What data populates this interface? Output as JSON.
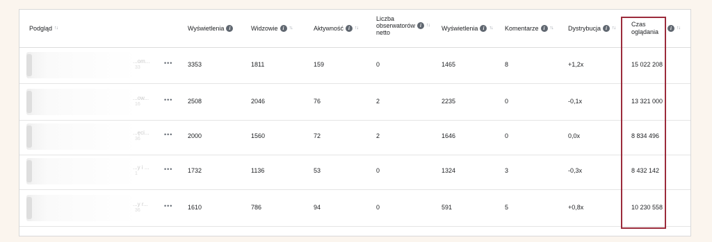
{
  "header": {
    "preview": "Podgląd",
    "views": "Wyświetlenia",
    "viewers": "Widzowie",
    "activity": "Aktywność",
    "followers_l1": "Liczba",
    "followers_l2": "obserwatorów",
    "followers_l3": "netto",
    "views2": "Wyświetlenia",
    "comments": "Komentarze",
    "distribution": "Dystrybucja",
    "watch_l1": "Czas",
    "watch_l2": "oglądania"
  },
  "icons": {
    "info": "info-icon",
    "sort": "sort-arrows-icon",
    "more": "more-options-icon"
  },
  "highlight_color": "#9b2a3a",
  "rows": [
    {
      "title": "...om...",
      "sub": "33",
      "views": "3353",
      "viewers": "1811",
      "activity": "159",
      "followers": "0",
      "views2": "1465",
      "comments": "8",
      "distribution": "+1,2x",
      "watch_time": "15 022 208"
    },
    {
      "title": "...ow...",
      "sub": "16",
      "views": "2508",
      "viewers": "2046",
      "activity": "76",
      "followers": "2",
      "views2": "2235",
      "comments": "0",
      "distribution": "-0,1x",
      "watch_time": "13 321 000"
    },
    {
      "title": "...ęci...",
      "sub": "36",
      "views": "2000",
      "viewers": "1560",
      "activity": "72",
      "followers": "2",
      "views2": "1646",
      "comments": "0",
      "distribution": "0,0x",
      "watch_time": "8 834 496"
    },
    {
      "title": "...y i ...",
      "sub": "1",
      "views": "1732",
      "viewers": "1136",
      "activity": "53",
      "followers": "0",
      "views2": "1324",
      "comments": "3",
      "distribution": "-0,3x",
      "watch_time": "8 432 142"
    },
    {
      "title": "...y r...",
      "sub": "36",
      "views": "1610",
      "viewers": "786",
      "activity": "94",
      "followers": "0",
      "views2": "591",
      "comments": "5",
      "distribution": "+0,8x",
      "watch_time": "10 230 558"
    }
  ]
}
